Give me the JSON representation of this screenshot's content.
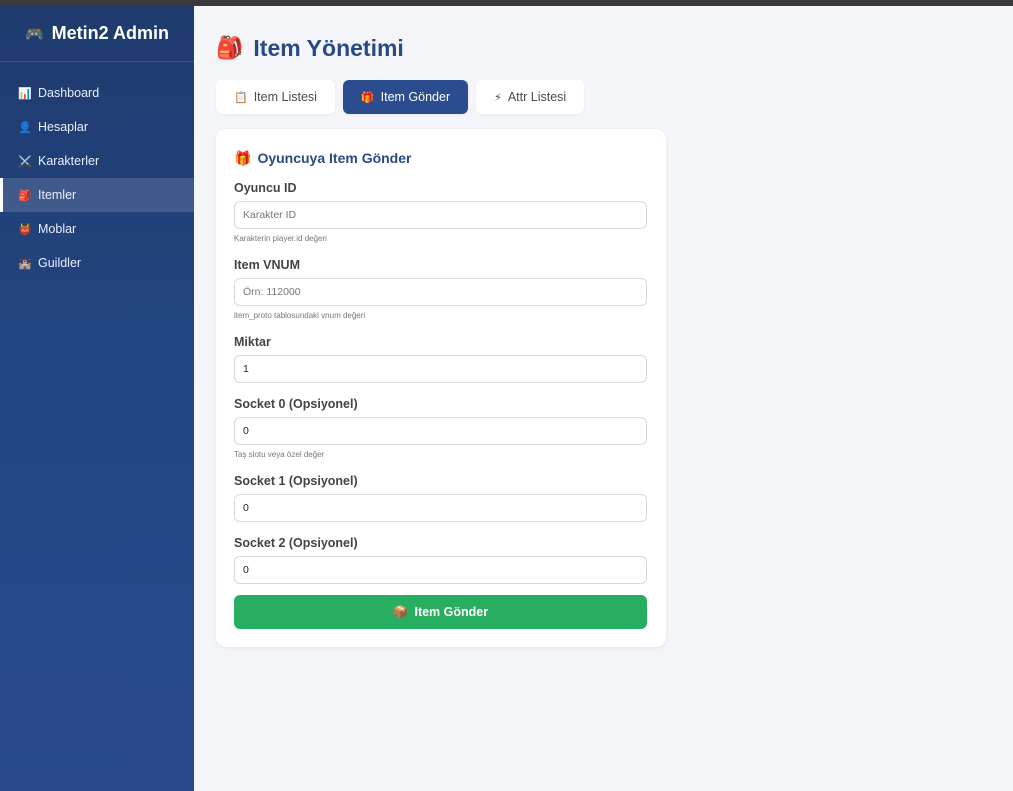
{
  "brand": {
    "icon": "🎮",
    "title": "Metin2 Admin"
  },
  "sidebar": {
    "items": [
      {
        "icon": "📊",
        "label": "Dashboard"
      },
      {
        "icon": "👤",
        "label": "Hesaplar"
      },
      {
        "icon": "⚔️",
        "label": "Karakterler"
      },
      {
        "icon": "🎒",
        "label": "Itemler",
        "active": true
      },
      {
        "icon": "👹",
        "label": "Moblar"
      },
      {
        "icon": "🏰",
        "label": "Guildler"
      }
    ]
  },
  "header": {
    "icon": "🎒",
    "title": "Item Yönetimi"
  },
  "tabs": [
    {
      "icon": "📋",
      "label": "Item Listesi"
    },
    {
      "icon": "🎁",
      "label": "Item Gönder",
      "active": true
    },
    {
      "icon": "⚡",
      "label": "Attr Listesi"
    }
  ],
  "form": {
    "title_icon": "🎁",
    "title": "Oyuncuya Item Gönder",
    "fields": {
      "player_id": {
        "label": "Oyuncu ID",
        "placeholder": "Karakter ID",
        "value": "",
        "help": "Karakterin player.id değeri"
      },
      "vnum": {
        "label": "Item VNUM",
        "placeholder": "Örn: 112000",
        "value": "",
        "help": "item_proto tablosundaki vnum değeri"
      },
      "count": {
        "label": "Miktar",
        "value": "1"
      },
      "socket0": {
        "label": "Socket 0 (Opsiyonel)",
        "value": "0",
        "help": "Taş slotu veya özel değer"
      },
      "socket1": {
        "label": "Socket 1 (Opsiyonel)",
        "value": "0"
      },
      "socket2": {
        "label": "Socket 2 (Opsiyonel)",
        "value": "0"
      }
    },
    "submit": {
      "icon": "📦",
      "label": "Item Gönder"
    }
  },
  "colors": {
    "sidebar": "#234684",
    "accent": "#2b4d8f",
    "submit": "#27ae60",
    "title": "#2a4a86"
  }
}
